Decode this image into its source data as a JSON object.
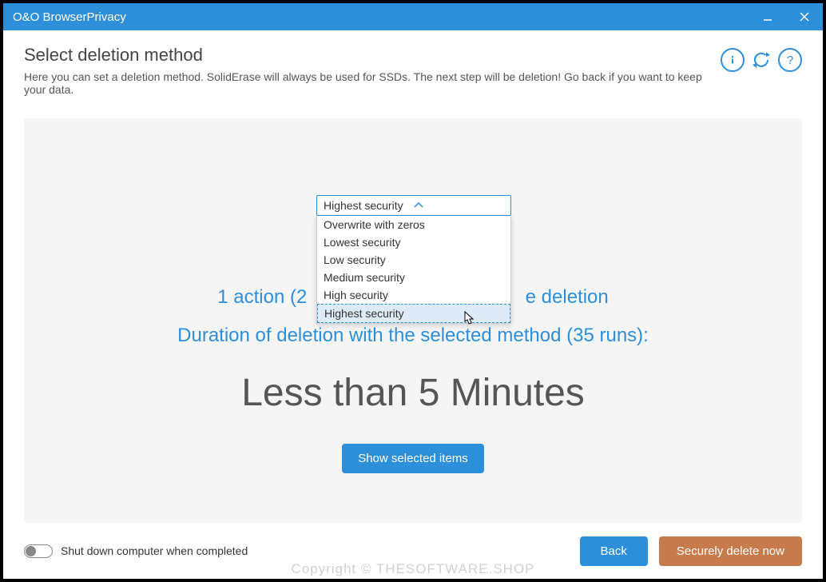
{
  "titlebar": {
    "title": "O&O BrowserPrivacy"
  },
  "header": {
    "title": "Select deletion method",
    "subtitle": "Here you can set a deletion method. SolidErase will always be used for SSDs. The next step will be deletion! Go back if you want to keep your data."
  },
  "dropdown": {
    "selected": "Highest security",
    "options": [
      "Overwrite with zeros",
      "Lowest security",
      "Low security",
      "Medium security",
      "High security",
      "Highest security"
    ],
    "highlighted_index": 5
  },
  "summary": {
    "line1_before": "1 action (2",
    "line1_after": "e deletion",
    "line2": "Duration of deletion with the selected method (35 runs):",
    "duration": "Less than 5 Minutes"
  },
  "buttons": {
    "show_selected": "Show selected items",
    "back": "Back",
    "delete_now": "Securely delete now"
  },
  "footer": {
    "toggle_label": "Shut down computer when completed",
    "toggle_on": false
  },
  "watermark": "Copyright © THESOFTWARE.SHOP"
}
